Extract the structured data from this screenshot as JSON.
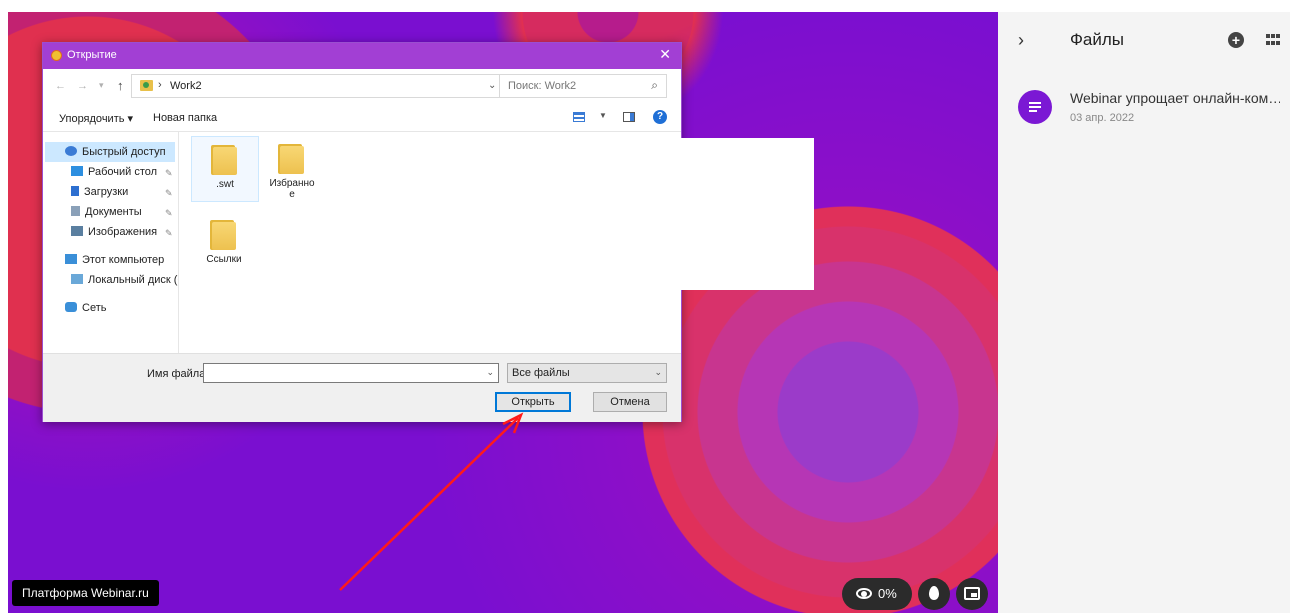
{
  "sidebar": {
    "title": "Файлы",
    "file_name": "Webinar упрощает онлайн-ком…",
    "file_date": "03 апр. 2022"
  },
  "dialog": {
    "title": "Открытие",
    "path": "Work2",
    "search_placeholder": "Поиск: Work2",
    "toolbar": {
      "organize": "Упорядочить ▾",
      "new_folder": "Новая папка"
    },
    "nav": [
      "Быстрый доступ",
      "Рабочий стол",
      "Загрузки",
      "Документы",
      "Изображения",
      "Этот компьютер",
      "Локальный диск (С",
      "Сеть"
    ],
    "folders": [
      ".swt",
      "Избранное",
      "Ссылки"
    ],
    "filename_label": "Имя файла:",
    "filename_value": "",
    "filetype": "Все файлы",
    "open_button": "Открыть",
    "cancel_button": "Отмена"
  },
  "overlay": {
    "brand": "Платформа Webinar.ru",
    "views_percent": "0%"
  },
  "colors": {
    "accent_purple": "#7b18d4",
    "titlebar": "#a23fd4",
    "arrow": "#ff1a1a"
  }
}
